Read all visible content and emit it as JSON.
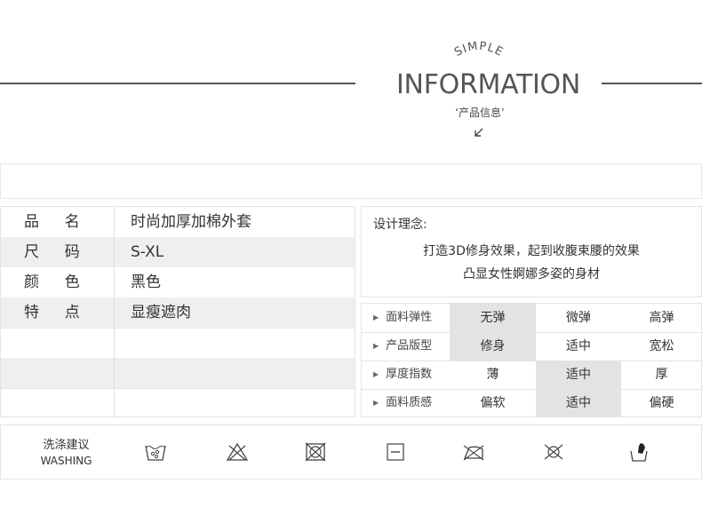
{
  "header": {
    "simple": "SIMPLE",
    "title": "INFORMATION",
    "subtitle": "‘产品信息’"
  },
  "product_info": {
    "rows": [
      {
        "key": "品  名",
        "value": "时尚加厚加棉外套"
      },
      {
        "key": "尺  码",
        "value": "S-XL"
      },
      {
        "key": "颜  色",
        "value": "黑色"
      },
      {
        "key": "特  点",
        "value": "显瘦遮肉"
      }
    ]
  },
  "design": {
    "title": "设计理念:",
    "line1": "打造3D修身效果，起到收腹束腰的效果",
    "line2": "凸显女性婀娜多姿的身材"
  },
  "attributes": [
    {
      "label": "面料弹性",
      "options": [
        "无弹",
        "微弹",
        "高弹"
      ],
      "selected": 0
    },
    {
      "label": "产品版型",
      "options": [
        "修身",
        "适中",
        "宽松"
      ],
      "selected": 0
    },
    {
      "label": "厚度指数",
      "options": [
        "薄",
        "适中",
        "厚"
      ],
      "selected": 1
    },
    {
      "label": "面料质感",
      "options": [
        "偏软",
        "适中",
        "偏硬"
      ],
      "selected": 1
    }
  ],
  "washing": {
    "label_cn": "洗涤建议",
    "label_en": "WASHING",
    "icons": [
      "hand-wash-icon",
      "no-bleach-icon",
      "no-tumble-dry-icon",
      "dry-flat-icon",
      "iron-low-icon",
      "no-dry-clean-icon",
      "hand-wash-gloves-icon"
    ]
  }
}
